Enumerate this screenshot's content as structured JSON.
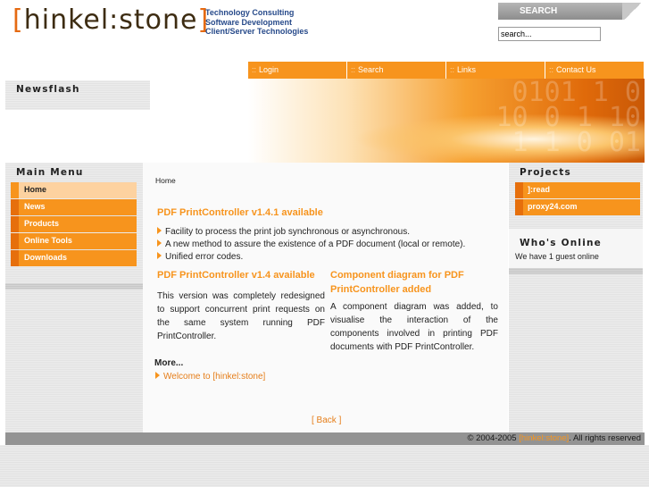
{
  "header": {
    "logo": {
      "bracket_open": "[",
      "name": "hinkel:stone",
      "bracket_close": "]"
    },
    "tagline": [
      "Technology Consulting",
      "Software Development",
      "Client/Server Technologies"
    ],
    "search": {
      "heading": "SEARCH",
      "placeholder": "search..."
    }
  },
  "topnav": {
    "separator": "::",
    "items": [
      "Login",
      "Search",
      "Links",
      "Contact Us"
    ]
  },
  "newsflash": {
    "heading": "Newsflash"
  },
  "main_menu": {
    "heading": "Main Menu",
    "items": [
      "Home",
      "News",
      "Products",
      "Online Tools",
      "Downloads"
    ],
    "active": "Home"
  },
  "breadcrumb": "Home",
  "articles": {
    "featured": {
      "title": "PDF PrintController v1.4.1 available",
      "bullets": [
        "Facility to process the print job synchronous or asynchronous.",
        "A new method to assure the existence of a PDF document (local or remote).",
        "Unified error codes."
      ]
    },
    "left": {
      "title": "PDF PrintController v1.4 available",
      "body": "This version was completely redesigned to support concurrent print requests on the same system running PDF PrintController."
    },
    "right": {
      "title": "Component diagram for PDF PrintController added",
      "body": "A component diagram was added, to visualise the interaction of the components involved in printing PDF documents with PDF PrintController."
    }
  },
  "more": {
    "heading": "More...",
    "link": "Welcome to [hinkel:stone]"
  },
  "back_link": "[ Back ]",
  "projects": {
    "heading": "Projects",
    "items": [
      "]:read",
      "proxy24.com"
    ]
  },
  "whos_online": {
    "heading": "Who's Online",
    "text": "We have 1 guest online"
  },
  "footer": {
    "prefix": "© 2004-2005",
    "brand": "[hinkel:stone]",
    "suffix": ". All rights reserved"
  },
  "colors": {
    "accent": "#f7941d",
    "accent_dark": "#e66f0c",
    "active_item": "#fdd2a0",
    "tagline": "#274a8a",
    "logo_text": "#3d2c12"
  }
}
